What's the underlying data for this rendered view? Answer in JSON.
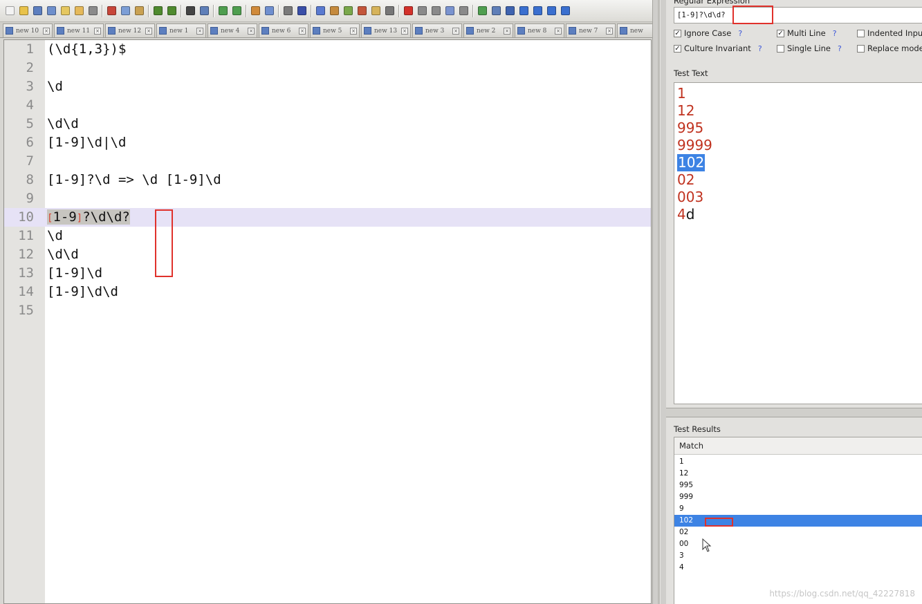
{
  "toolbar": {
    "buttons": [
      {
        "name": "new-file-icon",
        "color": "#f3f3f3"
      },
      {
        "name": "open-file-icon",
        "color": "#e8c24a"
      },
      {
        "name": "save-icon",
        "color": "#5d7fbf"
      },
      {
        "name": "save-all-icon",
        "color": "#6e8fcc"
      },
      {
        "name": "close-icon",
        "color": "#e5c760"
      },
      {
        "name": "close-all-icon",
        "color": "#e5b95a"
      },
      {
        "name": "print-icon",
        "color": "#8b8b8b"
      },
      {
        "sep": true
      },
      {
        "name": "cut-icon",
        "color": "#c7463a"
      },
      {
        "name": "copy-icon",
        "color": "#7c9ed6"
      },
      {
        "name": "paste-icon",
        "color": "#c9a152"
      },
      {
        "sep": true
      },
      {
        "name": "undo-icon",
        "color": "#4f8a2e"
      },
      {
        "name": "redo-icon",
        "color": "#4f8a2e"
      },
      {
        "sep": true
      },
      {
        "name": "find-icon",
        "color": "#444444"
      },
      {
        "name": "replace-icon",
        "color": "#5f7fb8"
      },
      {
        "sep": true
      },
      {
        "name": "zoom-in-icon",
        "color": "#4f9e4f"
      },
      {
        "name": "zoom-out-icon",
        "color": "#4f9e4f"
      },
      {
        "sep": true
      },
      {
        "name": "sync-vertical-icon",
        "color": "#d08a3a"
      },
      {
        "name": "sync-horizontal-icon",
        "color": "#6f8fcf"
      },
      {
        "sep": true
      },
      {
        "name": "word-wrap-icon",
        "color": "#7a7a7a"
      },
      {
        "name": "show-all-chars-icon",
        "color": "#3a4fa8"
      },
      {
        "sep": true
      },
      {
        "name": "indent-guide-icon",
        "color": "#5a7ad0"
      },
      {
        "name": "function-list-icon",
        "color": "#c58a3d"
      },
      {
        "name": "document-map-icon",
        "color": "#7aa84b"
      },
      {
        "name": "pen-icon",
        "color": "#c3553a"
      },
      {
        "name": "folder-icon",
        "color": "#d6b35a"
      },
      {
        "name": "monitor-icon",
        "color": "#777777"
      },
      {
        "sep": true
      },
      {
        "name": "record-macro-icon",
        "color": "#d3312a"
      },
      {
        "name": "stop-macro-icon",
        "color": "#8a8a8a"
      },
      {
        "name": "play-macro-icon",
        "color": "#8a8a8a"
      },
      {
        "name": "run-macro-icon",
        "color": "#7a93cf"
      },
      {
        "name": "save-macro-icon",
        "color": "#8a8a8a"
      },
      {
        "sep": true
      },
      {
        "name": "plugin-icon",
        "color": "#4f9e4f"
      },
      {
        "name": "table-icon",
        "color": "#5f7fb8"
      },
      {
        "name": "grid-icon",
        "color": "#3e63b0"
      },
      {
        "name": "collapse-icon",
        "color": "#3a6fcf"
      },
      {
        "name": "arrow-up-icon",
        "color": "#3a6fcf"
      },
      {
        "name": "arrow-down-icon",
        "color": "#3a6fcf"
      },
      {
        "name": "expand-icon",
        "color": "#3a6fcf"
      }
    ]
  },
  "tabs": [
    {
      "label": "new 10"
    },
    {
      "label": "new 11"
    },
    {
      "label": "new 12"
    },
    {
      "label": "new 1"
    },
    {
      "label": "new 4"
    },
    {
      "label": "new 6"
    },
    {
      "label": "new 5"
    },
    {
      "label": "new 13"
    },
    {
      "label": "new 3"
    },
    {
      "label": "new 2"
    },
    {
      "label": "new 8"
    },
    {
      "label": "new 7"
    },
    {
      "label": "new"
    }
  ],
  "tab_scroll": {
    "left": "◂",
    "right": "▸"
  },
  "tab_close_glyph": "×",
  "editor": {
    "lines": [
      {
        "num": "1",
        "text": "(\\d{1,3})$"
      },
      {
        "num": "2",
        "text": ""
      },
      {
        "num": "3",
        "text": "\\d"
      },
      {
        "num": "4",
        "text": ""
      },
      {
        "num": "5",
        "text": "\\d\\d"
      },
      {
        "num": "6",
        "text": "[1-9]\\d|\\d"
      },
      {
        "num": "7",
        "text": ""
      },
      {
        "num": "8",
        "text": "[1-9]?\\d => \\d [1-9]\\d"
      },
      {
        "num": "9",
        "text": ""
      },
      {
        "num": "10",
        "text": "",
        "current": true
      },
      {
        "num": "11",
        "text": "\\d"
      },
      {
        "num": "12",
        "text": "\\d\\d"
      },
      {
        "num": "13",
        "text": "[1-9]\\d"
      },
      {
        "num": "14",
        "text": "[1-9]\\d\\d"
      },
      {
        "num": "15",
        "text": ""
      }
    ],
    "current_line": {
      "open_bracket": "[",
      "inner": "1-9",
      "close_bracket": "]",
      "rest": "?\\d\\d?"
    }
  },
  "regex": {
    "caption": "Regular Expression",
    "value": "[1-9]?\\d\\d?"
  },
  "options": {
    "ignore_case": {
      "label": "Ignore Case",
      "checked": true
    },
    "multi_line": {
      "label": "Multi Line",
      "checked": true
    },
    "indented_input": {
      "label": "Indented Input",
      "checked": false
    },
    "culture_invariant": {
      "label": "Culture Invariant",
      "checked": true
    },
    "single_line": {
      "label": "Single Line",
      "checked": false
    },
    "replace_mode": {
      "label": "Replace mode",
      "checked": false
    },
    "help": "?",
    "check_glyph": "✓"
  },
  "test_text": {
    "caption": "Test Text",
    "lines": [
      {
        "text": "1"
      },
      {
        "text": "12"
      },
      {
        "text": "995"
      },
      {
        "text": "9999"
      },
      {
        "text": "102",
        "highlight": true
      },
      {
        "text": "02"
      },
      {
        "text": "003"
      },
      {
        "text": "4",
        "rest": "d"
      }
    ]
  },
  "results": {
    "caption": "Test Results",
    "column": "Match",
    "rows": [
      "1",
      "12",
      "995",
      "999",
      "9",
      "102",
      "02",
      "00",
      "3",
      "4"
    ],
    "selected_index": 5
  },
  "watermark": "https://blog.csdn.net/qq_42227818"
}
